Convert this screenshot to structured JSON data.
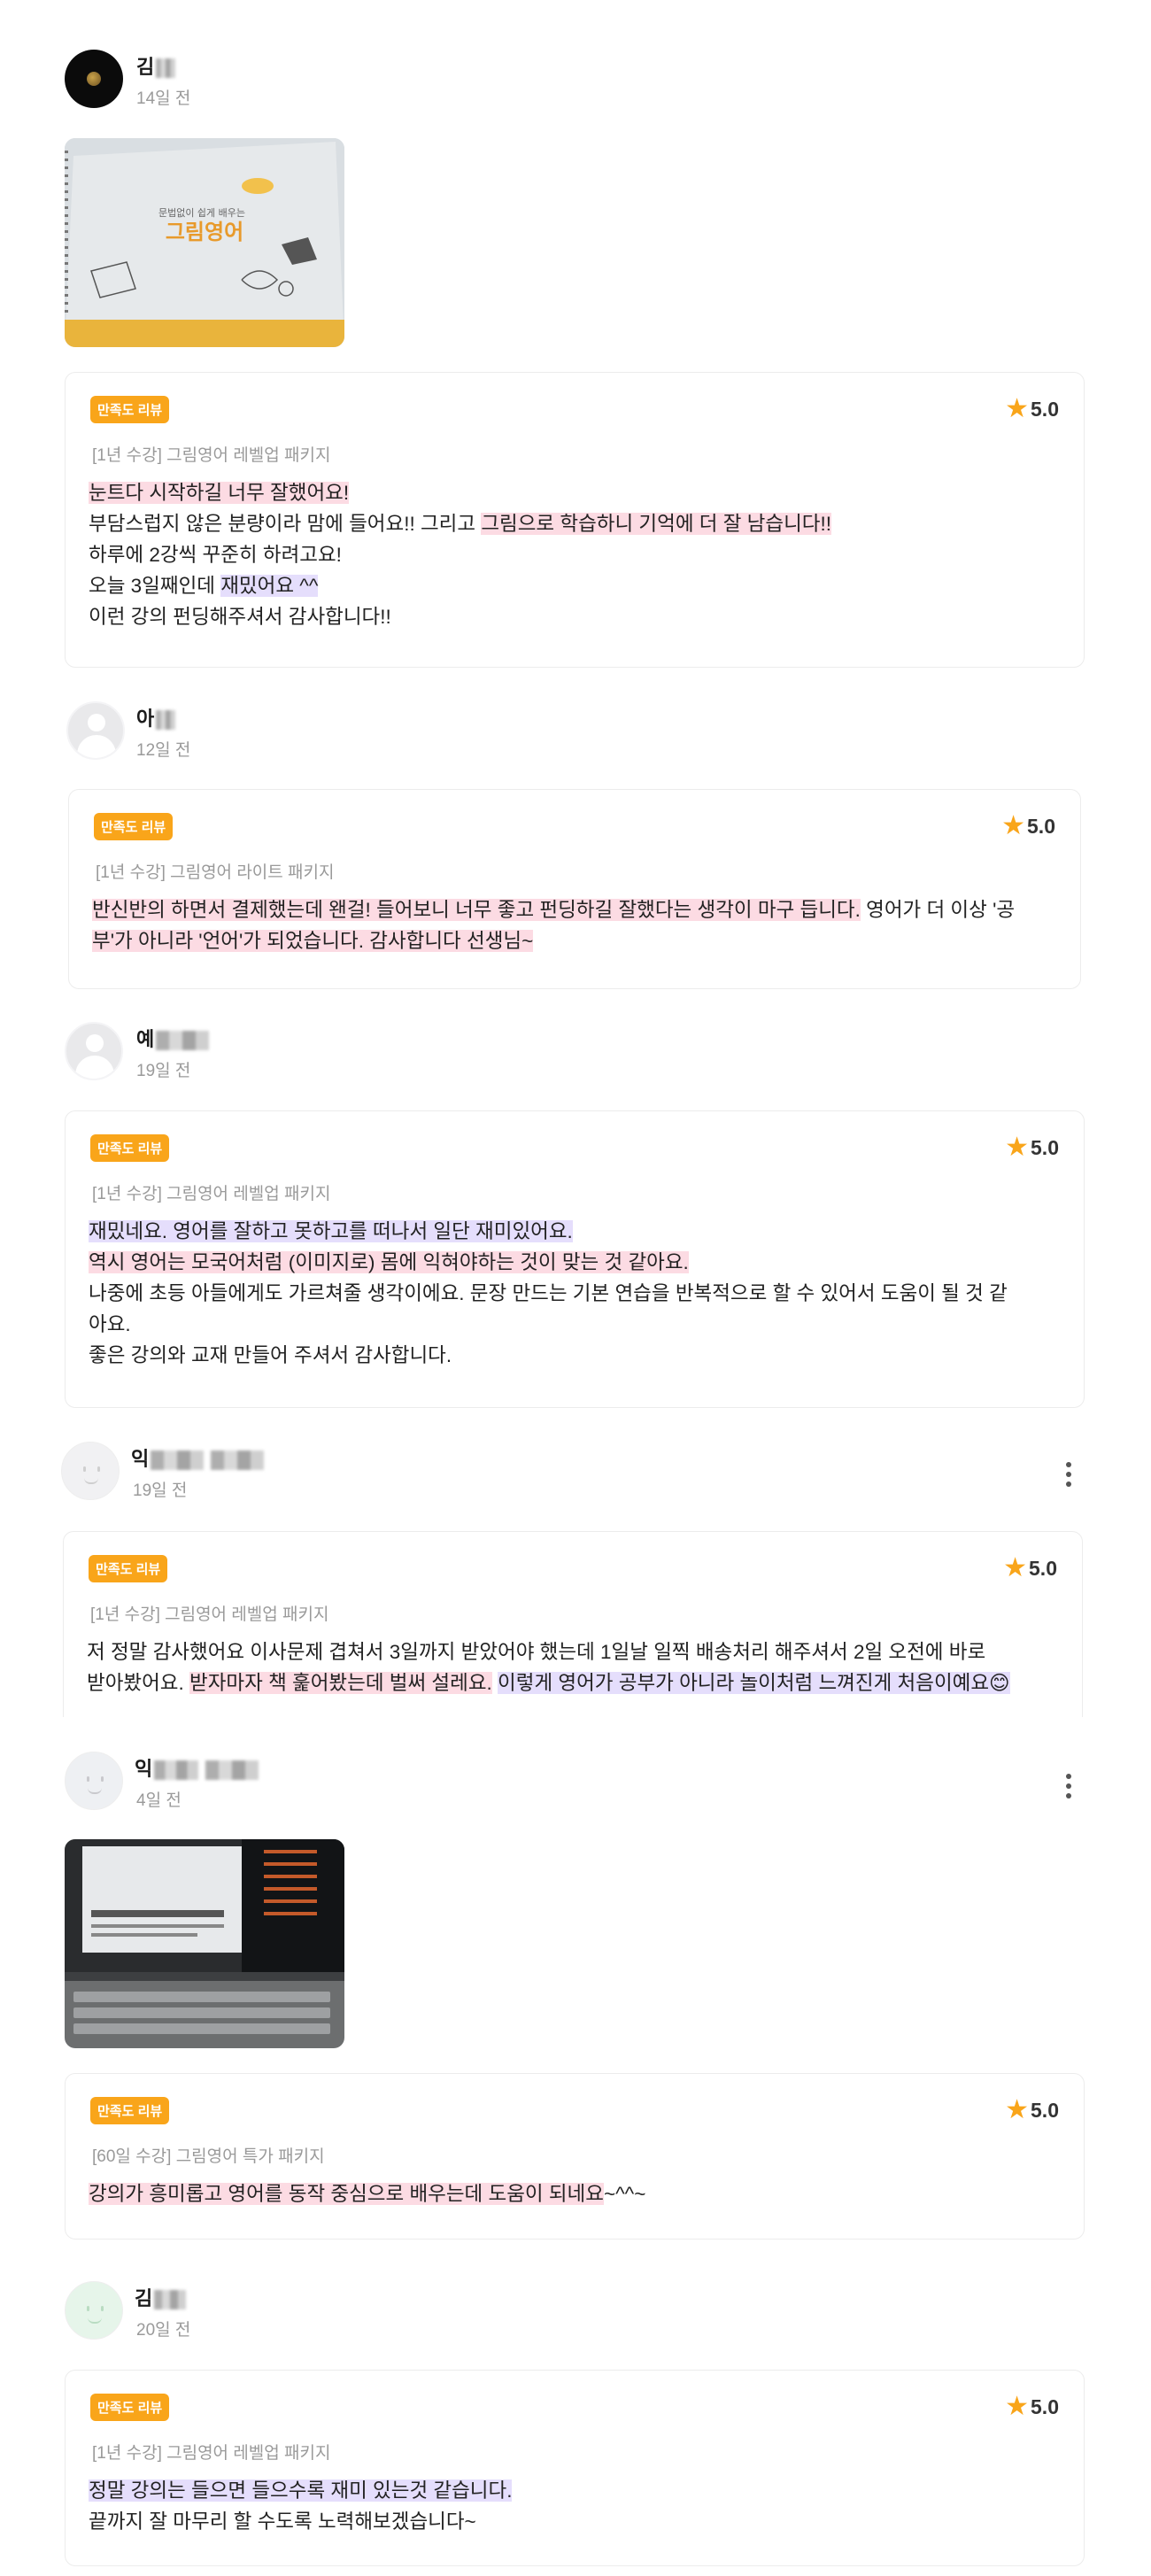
{
  "colors": {
    "badge": "#f9a51a",
    "star": "#f9a51a",
    "highlight_pink": "#fcdbe3",
    "highlight_purple": "#e5defc"
  },
  "reviews": [
    {
      "name": "김",
      "time": "14일 전",
      "badge": "만족도 리뷰",
      "rating": "5.0",
      "course": "[1년 수강] 그림영어 레벨업 패키지",
      "photo": {
        "book_top": "문법없이 쉽게 배우는",
        "book_title": "그림영어"
      },
      "lines": [
        [
          {
            "t": "눈트다 시작하길 너무 잘했어요!",
            "h": "pink"
          }
        ],
        [
          {
            "t": "부담스럽지 않은 분량이라 맘에 들어요!! 그리고 ",
            "h": ""
          },
          {
            "t": "그림으로 학습하니 기억에 더 잘 남습니다!!",
            "h": "pink"
          }
        ],
        [
          {
            "t": "하루에 2강씩 꾸준히 하려고요!",
            "h": ""
          }
        ],
        [
          {
            "t": "오늘 3일째인데 ",
            "h": ""
          },
          {
            "t": "재밌어요 ^^",
            "h": "purple"
          }
        ],
        [
          {
            "t": "이런 강의 펀딩해주셔서 감사합니다!!",
            "h": ""
          }
        ]
      ]
    },
    {
      "name": "아",
      "time": "12일 전",
      "badge": "만족도 리뷰",
      "rating": "5.0",
      "course": "[1년 수강] 그림영어 라이트 패키지",
      "lines": [
        [
          {
            "t": "반신반의 하면서 결제했는데 왠걸! 들어보니 너무 좋고 펀딩하길 잘했다는 생각이 마구 듭니다.",
            "h": "pink"
          },
          {
            "t": " 영어가 더 이상 '공",
            "h": ""
          }
        ],
        [
          {
            "t": "부'가 아니라 '언어'가 되었습니다. 감사합니다 선생님~",
            "h": "pink"
          }
        ]
      ]
    },
    {
      "name": "예",
      "time": "19일 전",
      "badge": "만족도 리뷰",
      "rating": "5.0",
      "course": "[1년 수강] 그림영어 레벨업 패키지",
      "lines": [
        [
          {
            "t": "재밌네요. 영어를 잘하고 못하고를 떠나서 일단 재미있어요.",
            "h": "purple"
          }
        ],
        [
          {
            "t": "역시 영어는 모국어처럼 (이미지로) 몸에 익혀야하는 것이 맞는 것 같아요.",
            "h": "pink"
          }
        ],
        [
          {
            "t": "나중에 초등 아들에게도 가르쳐줄 생각이에요. 문장 만드는 기본 연습을 반복적으로 할 수 있어서 도움이 될 것 같",
            "h": ""
          }
        ],
        [
          {
            "t": "아요.",
            "h": ""
          }
        ],
        [
          {
            "t": "좋은 강의와 교재 만들어 주셔서 감사합니다.",
            "h": ""
          }
        ]
      ]
    },
    {
      "name": "익",
      "time": "19일 전",
      "badge": "만족도 리뷰",
      "rating": "5.0",
      "course": "[1년 수강] 그림영어 레벨업 패키지",
      "lines": [
        [
          {
            "t": "저 정말 감사했어요 이사문제 겹쳐서 3일까지 받았어야 했는데 1일날 일찍 배송처리 해주셔서 2일 오전에 바로",
            "h": ""
          }
        ],
        [
          {
            "t": "받아봤어요. ",
            "h": ""
          },
          {
            "t": "받자마자 책 훑어봤는데 벌써 설레요.",
            "h": "pink"
          },
          {
            "t": " ",
            "h": ""
          },
          {
            "t": "이렇게 영어가 공부가 아니라 놀이처럼 느껴진게 처음이예요😊",
            "h": "purple"
          }
        ]
      ]
    },
    {
      "name": "익",
      "time": "4일 전",
      "badge": "만족도 리뷰",
      "rating": "5.0",
      "course": "[60일 수강] 그림영어 특가 패키지",
      "lines": [
        [
          {
            "t": "강의가 흥미롭고 영어를 동작 중심으로 배우는데 도움이 되네요",
            "h": "pink"
          },
          {
            "t": "~^^~",
            "h": ""
          }
        ]
      ]
    },
    {
      "name": "김",
      "time": "20일 전",
      "badge": "만족도 리뷰",
      "rating": "5.0",
      "course": "[1년 수강] 그림영어 레벨업 패키지",
      "lines": [
        [
          {
            "t": "정말 강의는 들으면 들으수록 재미 있는것 같습니다.",
            "h": "purple"
          }
        ],
        [
          {
            "t": "끝까지 잘 마무리 할 수도록 노력해보겠습니다~",
            "h": ""
          }
        ]
      ]
    }
  ]
}
